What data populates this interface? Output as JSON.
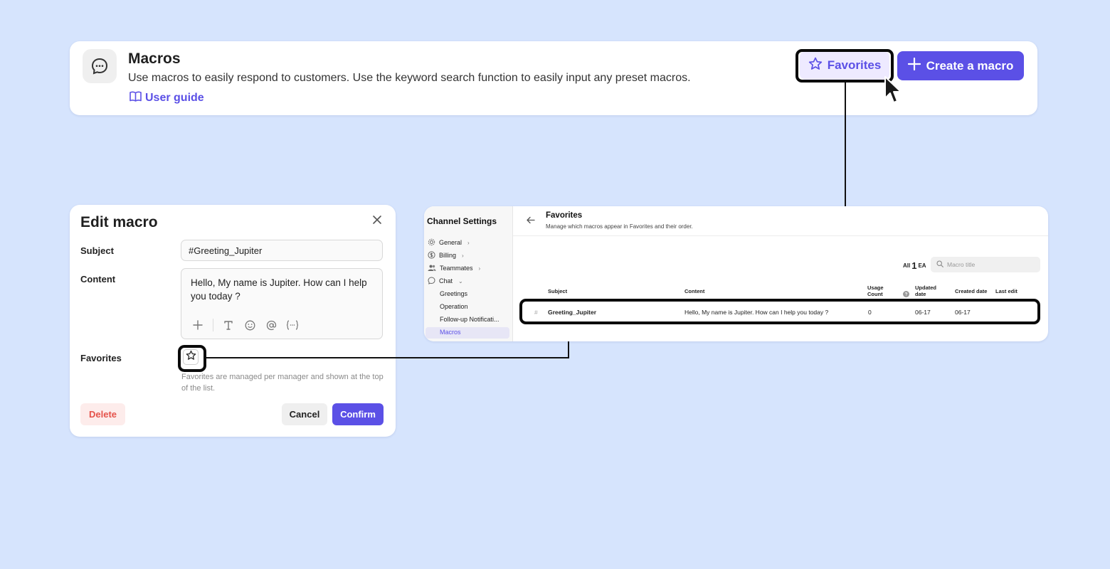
{
  "colors": {
    "background": "#d6e4fd",
    "accent": "#5b50e6",
    "danger": "#e5534b"
  },
  "macros_card": {
    "icon": "chat-bubble-icon",
    "title": "Macros",
    "description": "Use macros to easily respond to customers. Use the keyword search function to easily input any preset macros.",
    "guide_icon": "book-icon",
    "guide_label": "User guide",
    "favorites_label": "Favorites",
    "create_label": "Create a macro"
  },
  "edit_macro": {
    "title": "Edit macro",
    "subject_label": "Subject",
    "subject_value": "#Greeting_Jupiter",
    "content_label": "Content",
    "content_value": "Hello, My name is Jupiter. How can I help you today ?",
    "toolbar_icons": [
      "plus-icon",
      "text-icon",
      "emoji-icon",
      "mention-icon",
      "variable-icon"
    ],
    "favorites_label": "Favorites",
    "favorites_help": "Favorites are managed per manager and shown at the top of the list.",
    "delete_label": "Delete",
    "cancel_label": "Cancel",
    "confirm_label": "Confirm"
  },
  "channel_settings": {
    "sidebar_title": "Channel Settings",
    "nav": [
      {
        "label": "General",
        "icon": "gear-icon"
      },
      {
        "label": "Billing",
        "icon": "dollar-icon"
      },
      {
        "label": "Teammates",
        "icon": "people-icon"
      },
      {
        "label": "Chat",
        "icon": "chat-icon"
      }
    ],
    "chat_sub": [
      "Greetings",
      "Operation",
      "Follow-up Notificati...",
      "Macros"
    ],
    "active_item": "Macros",
    "page_title": "Favorites",
    "page_desc": "Manage which macros appear in Favorites and their order.",
    "count_prefix": "All",
    "count_value": "1",
    "count_suffix": "EA",
    "search_placeholder": "Macro title",
    "columns": {
      "subject": "Subject",
      "content": "Content",
      "usage_1": "Usage",
      "usage_2": "Count",
      "updated_1": "Updated",
      "updated_2": "date",
      "created": "Created date",
      "last_edit": "Last edit"
    },
    "rows": [
      {
        "subject": "Greeting_Jupiter",
        "content": "Hello, My name is Jupiter. How can I help you today ?",
        "usage": "0",
        "updated": "06-17",
        "created": "06-17",
        "last_edit": ""
      }
    ]
  }
}
